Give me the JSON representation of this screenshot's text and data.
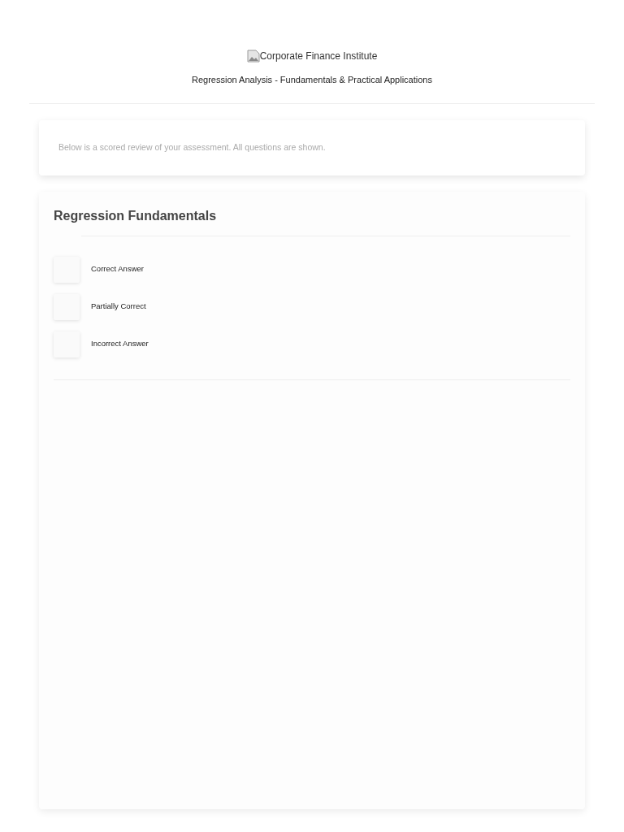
{
  "header": {
    "logo_alt": "Corporate Finance Institute",
    "course_title": "Regression Analysis - Fundamentals & Practical Applications"
  },
  "intro": {
    "text": "Below is a scored review of your assessment. All questions are shown."
  },
  "section": {
    "title": "Regression Fundamentals",
    "legend": [
      {
        "label": "Correct Answer"
      },
      {
        "label": "Partially Correct"
      },
      {
        "label": "Incorrect Answer"
      }
    ]
  }
}
